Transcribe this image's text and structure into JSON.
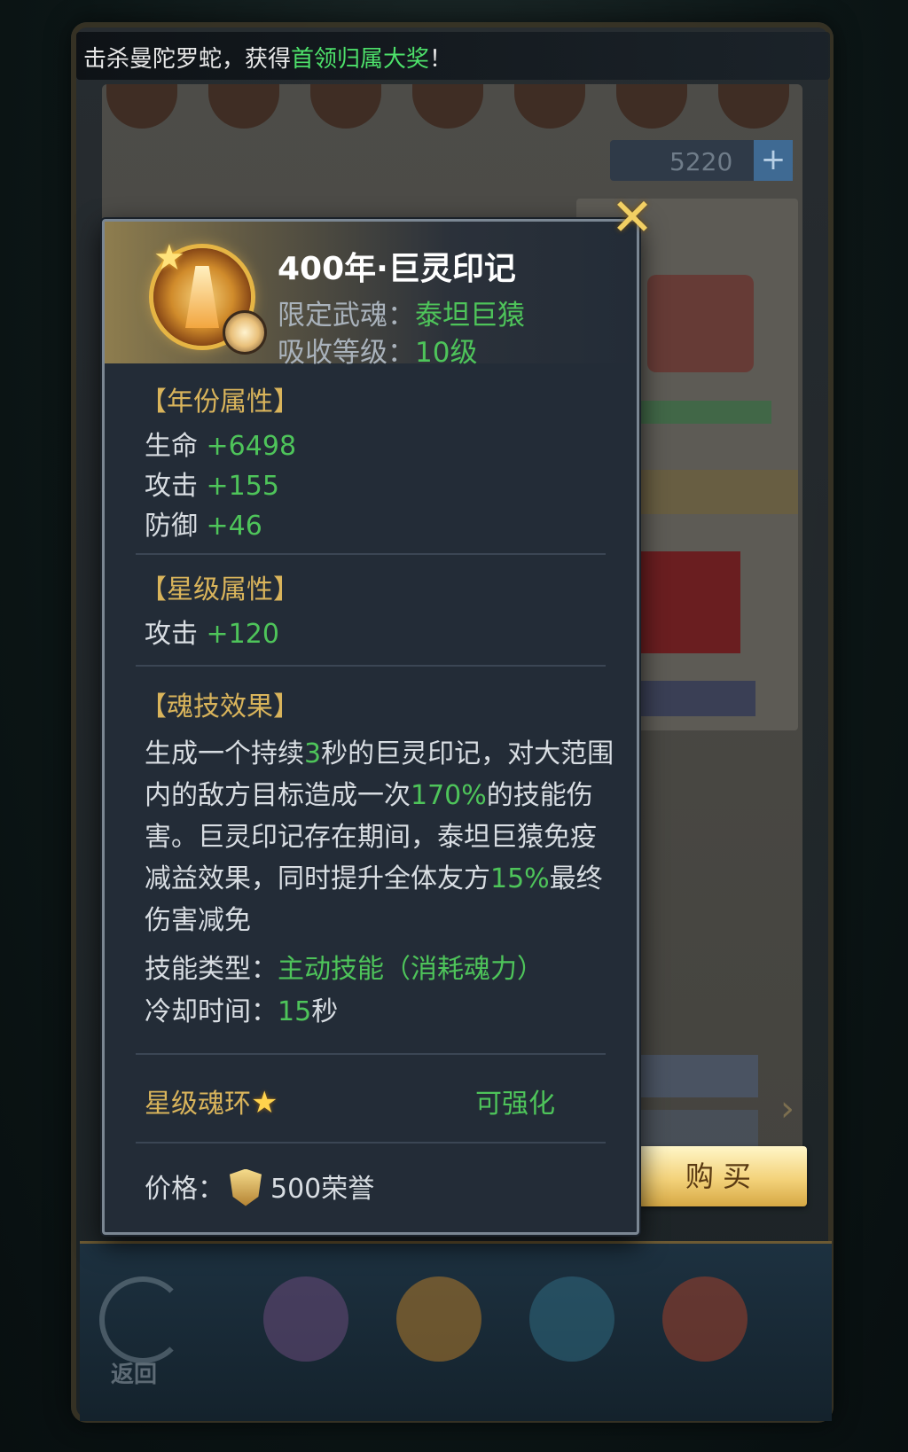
{
  "marquee": {
    "text_prefix": "击杀曼陀罗蛇，获得",
    "highlight": "首领归属大奖",
    "text_suffix": "！"
  },
  "shop": {
    "currency_value": "5220",
    "currency_add": "+"
  },
  "item": {
    "title": "400年·巨灵印记",
    "spirit_label": "限定武魂：",
    "spirit_value": "泰坦巨猿",
    "absorb_label": "吸收等级：",
    "absorb_value": "10级",
    "year_attr_title": "【年份属性】",
    "year_attrs": [
      {
        "label": "生命",
        "value": "+6498"
      },
      {
        "label": "攻击",
        "value": "+155"
      },
      {
        "label": "防御",
        "value": "+46"
      }
    ],
    "star_attr_title": "【星级属性】",
    "star_attrs": [
      {
        "label": "攻击",
        "value": "+120"
      }
    ],
    "skill_title": "【魂技效果】",
    "skill_desc": {
      "p1": "生成一个持续",
      "v1": "3",
      "p2": "秒的巨灵印记，对大范围内的敌方目标造成一次",
      "v2": "170%",
      "p3": "的技能伤害。巨灵印记存在期间，泰坦巨猿免疫减益效果，同时提升全体友方",
      "v3": "15%",
      "p4": "最终伤害减免"
    },
    "skill_type_label": "技能类型：",
    "skill_type_value": "主动技能（消耗魂力）",
    "cooldown_label": "冷却时间：",
    "cooldown_value": "15",
    "cooldown_unit": "秒",
    "star_ring_label": "星级魂环",
    "upgradable": "可强化",
    "price_label": "价格：",
    "price_value": "500荣誉"
  },
  "buy_label": "购买",
  "bottom_nav": {
    "back_label": "返回"
  },
  "icons": {
    "close": "close-icon",
    "star": "star-icon",
    "honor": "honor-shield-icon"
  },
  "colors": {
    "highlight_green": "#4ec45a",
    "gold_title": "#d9b45b",
    "panel_bg": "#232c37"
  }
}
